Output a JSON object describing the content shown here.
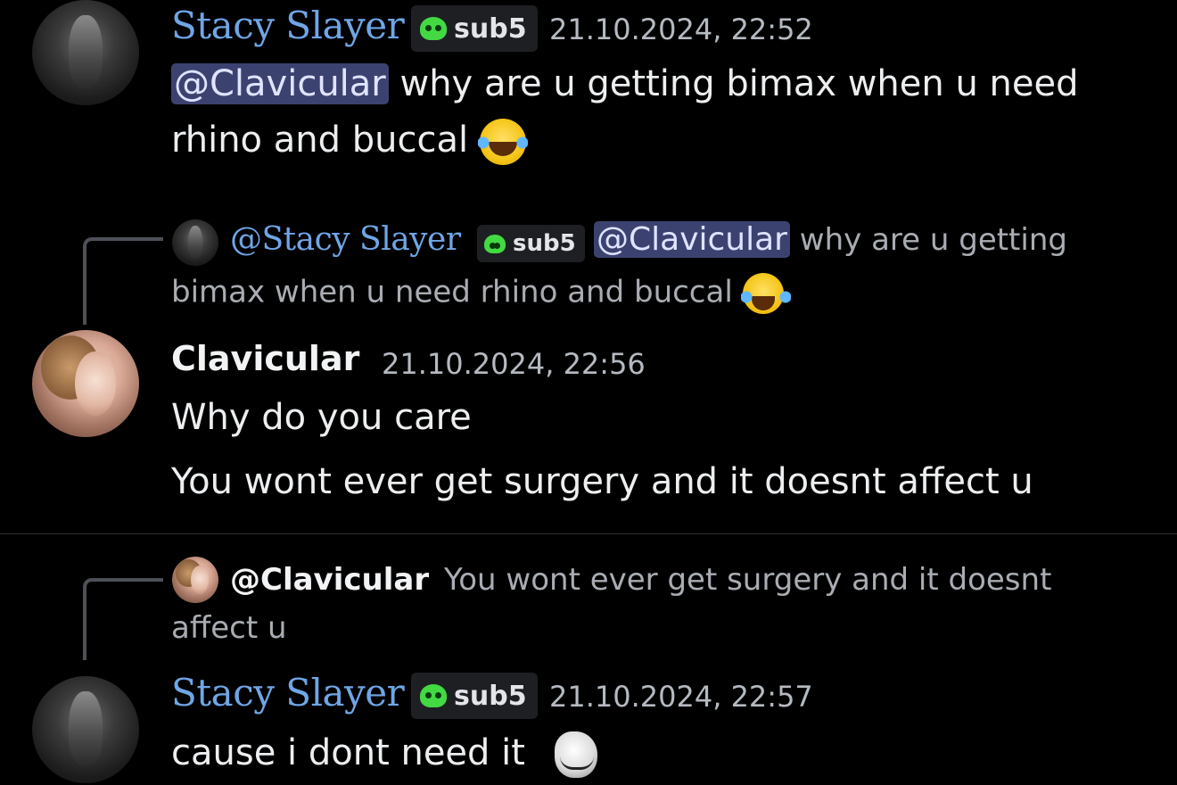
{
  "messages": [
    {
      "author": "Stacy Slayer",
      "badge": "sub5",
      "timestamp": "21.10.2024, 22:52",
      "mention": "@Clavicular",
      "text_line1": "why are u getting bimax when u need",
      "text_line2": "rhino and buccal",
      "emoji": "joy-emoji"
    },
    {
      "reply": {
        "author": "@Stacy Slayer",
        "badge": "sub5",
        "mention": "@Clavicular",
        "text_line1": "why are u getting",
        "text_line2": "bimax when u need rhino and buccal"
      },
      "author": "Clavicular",
      "timestamp": "21.10.2024, 22:56",
      "lines": [
        "Why do you care",
        "You wont ever get surgery and it doesnt affect u"
      ]
    },
    {
      "reply": {
        "author": "@Clavicular",
        "text_line1": "You wont ever get surgery and it doesnt",
        "text_line2": "affect u"
      },
      "author": "Stacy Slayer",
      "badge": "sub5",
      "timestamp": "21.10.2024, 22:57",
      "text": "cause i dont need it",
      "emoji": "trollface-emoji"
    }
  ],
  "colors": {
    "background": "#000000",
    "fancy_name": "#6fa6e6",
    "mention_bg": "#3c4270",
    "badge_icon": "#43d943"
  }
}
